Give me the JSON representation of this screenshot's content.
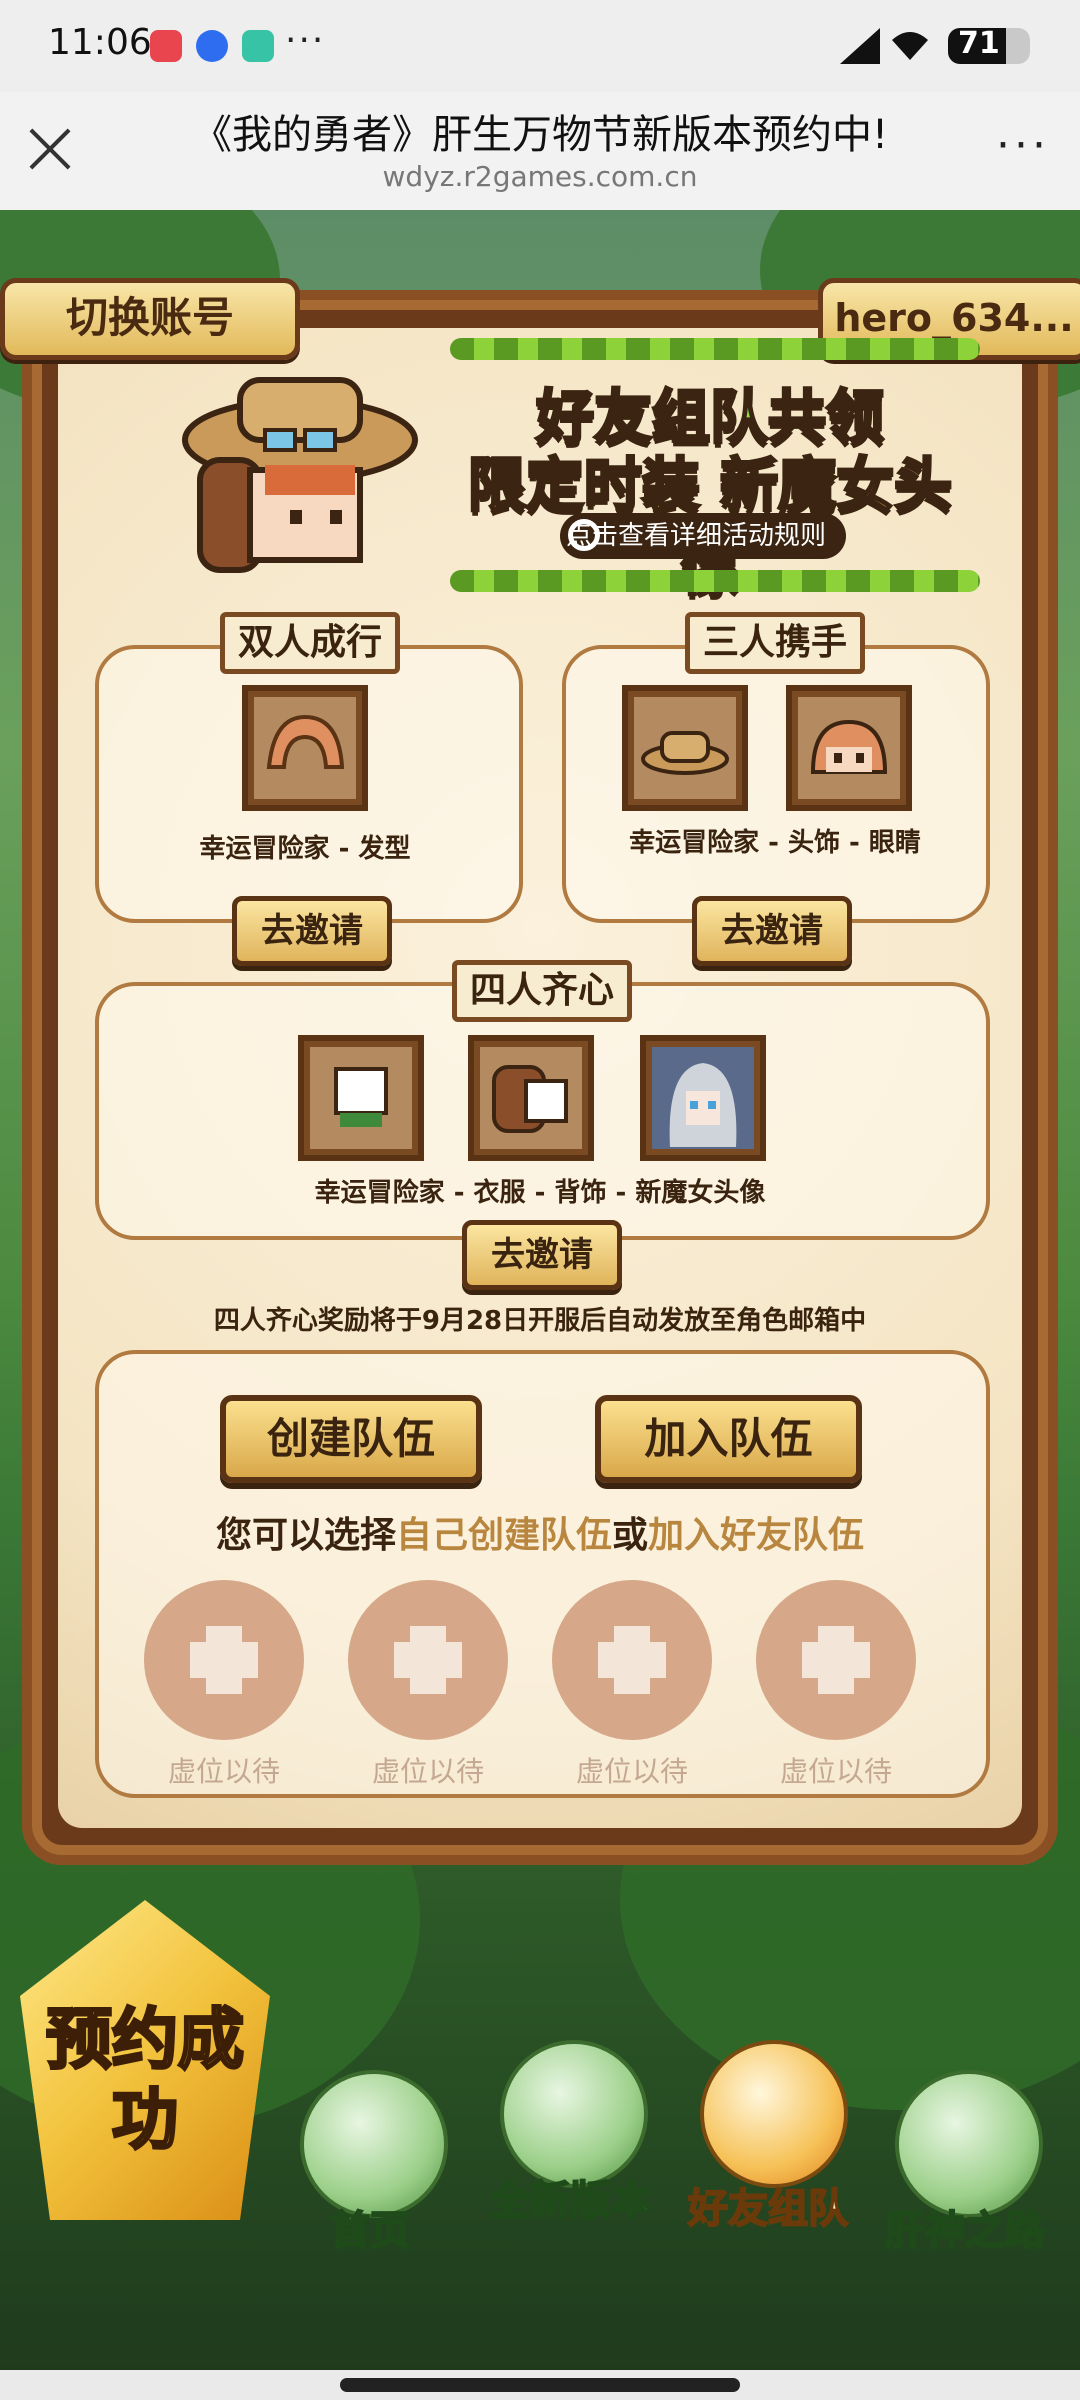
{
  "status": {
    "time": "11:06",
    "battery": "71",
    "battery_level": 0.71,
    "more": "···"
  },
  "browser": {
    "title": "《我的勇者》肝生万物节新版本预约中!",
    "url": "wdyz.r2games.com.cn",
    "more": "···"
  },
  "header": {
    "switch_account": "切换账号",
    "username": "hero_634..."
  },
  "promo": {
    "line1": "好友组队共领",
    "line2": "限定时装 新魔女头像",
    "rules": "点击查看详细活动规则"
  },
  "tiers": [
    {
      "title": "双人成行",
      "caption": "幸运冒险家 - 发型",
      "invite": "去邀请"
    },
    {
      "title": "三人携手",
      "caption": "幸运冒险家 - 头饰 - 眼睛",
      "invite": "去邀请"
    },
    {
      "title": "四人齐心",
      "caption": "幸运冒险家 - 衣服 - 背饰 - 新魔女头像",
      "invite": "去邀请"
    }
  ],
  "note": "四人齐心奖励将于9月28日开服后自动发放至角色邮箱中",
  "team": {
    "create": "创建队伍",
    "join": "加入队伍",
    "choose_prefix": "您可以选择",
    "choose_create": "自己创建队伍",
    "choose_or": "或",
    "choose_join": "加入好友队伍",
    "slots": [
      "虚位以待",
      "虚位以待",
      "虚位以待",
      "虚位以待"
    ]
  },
  "bottom": {
    "badge": "预约成功",
    "nav": [
      "首页",
      "全新版本",
      "好友组队",
      "肝神之路"
    ],
    "active_index": 2
  }
}
